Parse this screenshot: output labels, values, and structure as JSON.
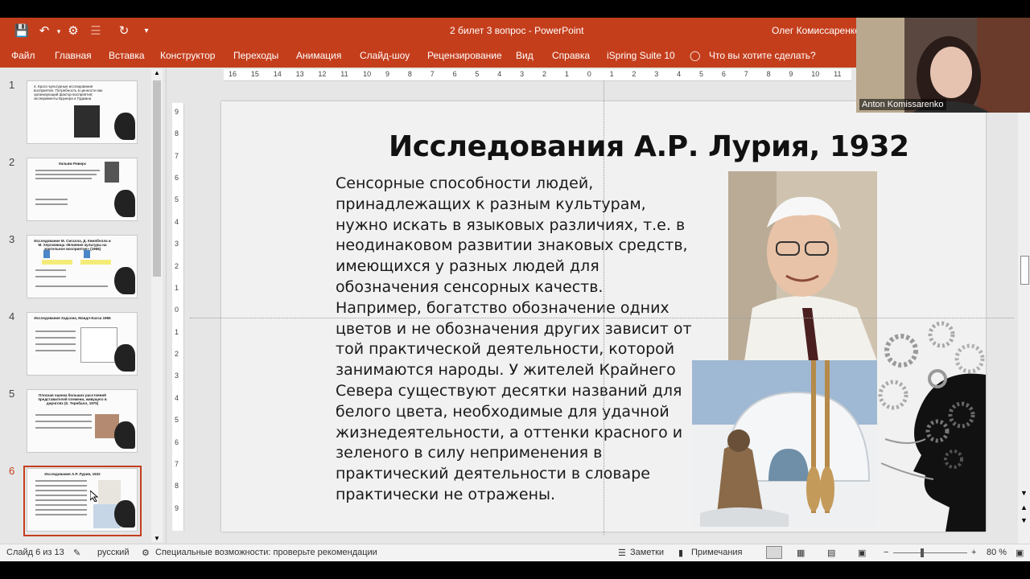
{
  "window": {
    "title": "2 билет 3 вопрос  -  PowerPoint",
    "user": "Олег Комиссаренко"
  },
  "ribbon": {
    "file": "Файл",
    "tabs": [
      "Главная",
      "Вставка",
      "Конструктор",
      "Переходы",
      "Анимация",
      "Слайд-шоу",
      "Рецензирование",
      "Вид",
      "Справка",
      "iSpring Suite 10"
    ],
    "tellme": "Что вы хотите сделать?"
  },
  "thumbnails": [
    {
      "num": "1",
      "title": "4. Кросс-культурные исследования восприятия. Потребность в ценности как организующий фактор восприятия; эксперименты Брунера и Гудмана"
    },
    {
      "num": "2",
      "title": "Уильям Риверс"
    },
    {
      "num": "3",
      "title": "Исследование М. Сигалла, Д. Кемпбелла и М. Херсковица «Влияние культуры на зрительное восприятие» (1966)"
    },
    {
      "num": "4",
      "title": "Исследования Хадсона, Мандл-Касса 1966"
    },
    {
      "num": "5",
      "title": "Плоская оценка больших расстояний представителей племени, живущего в джунглях (К. Тернбалл, 1975)"
    },
    {
      "num": "6",
      "title": "Исследования А.Р. Лурия, 1932"
    }
  ],
  "ruler": {
    "h_ticks": [
      "16",
      "15",
      "14",
      "13",
      "12",
      "11",
      "10",
      "9",
      "8",
      "7",
      "6",
      "5",
      "4",
      "3",
      "2",
      "1",
      "0",
      "1",
      "2",
      "3",
      "4",
      "5",
      "6",
      "7",
      "8",
      "9",
      "10",
      "11"
    ],
    "v_ticks": [
      "9",
      "8",
      "7",
      "6",
      "5",
      "4",
      "3",
      "2",
      "1",
      "0",
      "1",
      "2",
      "3",
      "4",
      "5",
      "6",
      "7",
      "8",
      "9"
    ]
  },
  "slide": {
    "title": "Исследования А.Р. Лурия, 1932",
    "body_lines": [
      "Сенсорные способности людей,",
      "принадлежащих к разным культурам,",
      "нужно искать в языковых различиях, т.е. в",
      "неодинаковом развитии знаковых средств,",
      "имеющихся у разных людей для",
      "обозначения сенсорных качеств.",
      "Например, богатство обозначение одних",
      "цветов и не обозначения других зависит от",
      "той практической деятельности, которой",
      "занимаются народы.  У жителей Крайнего",
      "Севера  существуют десятки названий для",
      "белого цвета, необходимые для удачной",
      "жизнедеятельности, а оттенки красного и",
      "зеленого в силу неприменения в",
      "практический деятельности в словаре",
      "практически не отражены."
    ]
  },
  "video": {
    "name": "Anton Komissarenko"
  },
  "status": {
    "slide_info": "Слайд 6 из 13",
    "language": "русский",
    "accessibility": "Специальные возможности: проверьте рекомендации",
    "notes": "Заметки",
    "comments": "Примечания",
    "zoom": "80 %"
  },
  "colors": {
    "accent": "#c43e1c"
  }
}
